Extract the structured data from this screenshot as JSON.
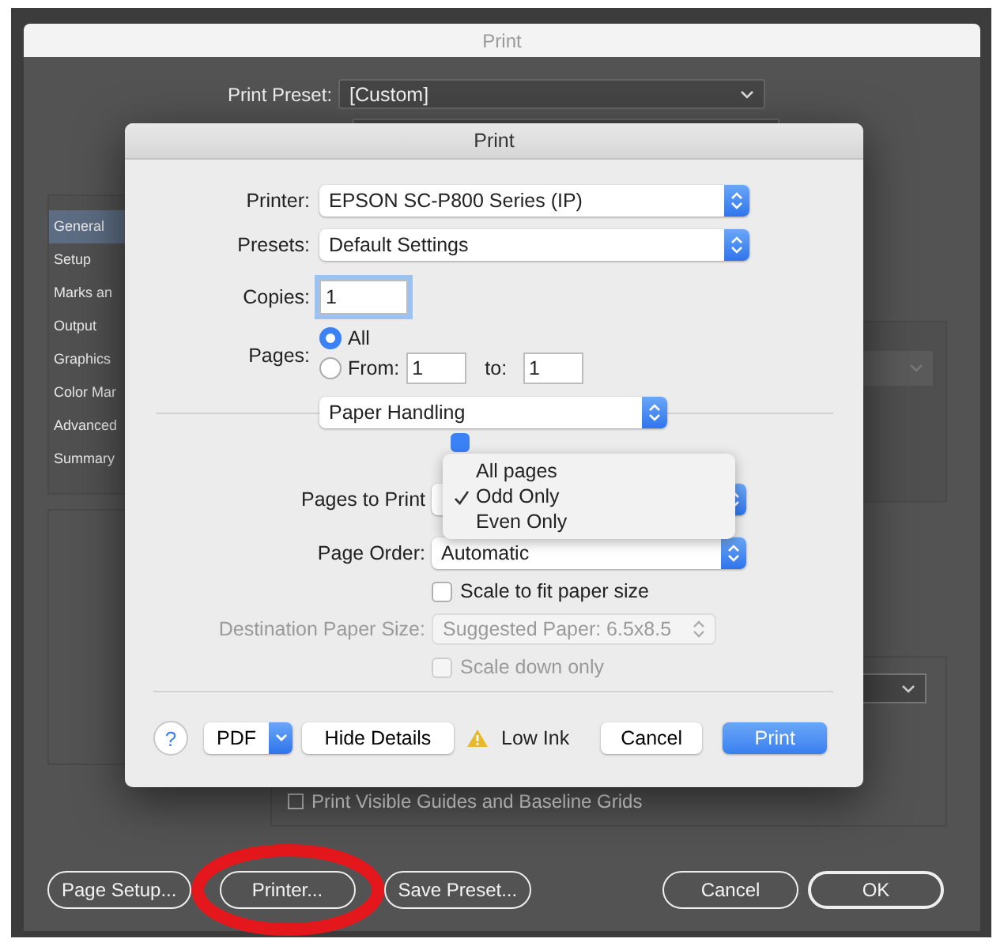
{
  "outer": {
    "title": "Print",
    "preset_label": "Print Preset:",
    "preset_value": "[Custom]",
    "sidebar": [
      {
        "label": "General",
        "selected": true
      },
      {
        "label": "Setup",
        "selected": false
      },
      {
        "label": "Marks an",
        "selected": false
      },
      {
        "label": "Output",
        "selected": false
      },
      {
        "label": "Graphics",
        "selected": false
      },
      {
        "label": "Color Mar",
        "selected": false
      },
      {
        "label": "Advanced",
        "selected": false
      },
      {
        "label": "Summary",
        "selected": false
      }
    ],
    "guides": {
      "label": "Print Visible Guides and Baseline Grids",
      "checked": false
    },
    "buttons": [
      {
        "label": "Page Setup...",
        "default": false,
        "highlighted": false
      },
      {
        "label": "Printer...",
        "default": false,
        "highlighted": true
      },
      {
        "label": "Save Preset...",
        "default": false,
        "highlighted": false
      },
      {
        "label": "Cancel",
        "default": false,
        "highlighted": false
      },
      {
        "label": "OK",
        "default": true,
        "highlighted": false
      }
    ]
  },
  "sheet": {
    "title": "Print",
    "printer": {
      "label": "Printer:",
      "value": "EPSON SC-P800 Series (IP)"
    },
    "presets": {
      "label": "Presets:",
      "value": "Default Settings"
    },
    "copies": {
      "label": "Copies:",
      "value": "1"
    },
    "pages": {
      "label": "Pages:",
      "options": [
        {
          "label": "All",
          "selected": true
        },
        {
          "label": "From:",
          "selected": false
        }
      ],
      "from": "1",
      "to_label": "to:",
      "to": "1"
    },
    "panel": "Paper Handling",
    "pages_to_print": {
      "label": "Pages to Print",
      "checkbox_checked": true,
      "menu": [
        {
          "label": "All pages",
          "checked": false
        },
        {
          "label": "Odd Only",
          "checked": true
        },
        {
          "label": "Even Only",
          "checked": false
        }
      ]
    },
    "page_order": {
      "label": "Page Order:",
      "value": "Automatic"
    },
    "scale_to_fit": {
      "label": "Scale to fit paper size",
      "checked": false
    },
    "destination": {
      "label": "Destination Paper Size:",
      "value": "Suggested Paper: 6.5x8.5",
      "disabled": true
    },
    "scale_down": {
      "label": "Scale down only",
      "checked": false,
      "disabled": true
    },
    "footer": {
      "help": "?",
      "pdf": "PDF",
      "hide_details": "Hide Details",
      "low_ink": "Low Ink",
      "cancel": "Cancel",
      "print": "Print"
    }
  }
}
